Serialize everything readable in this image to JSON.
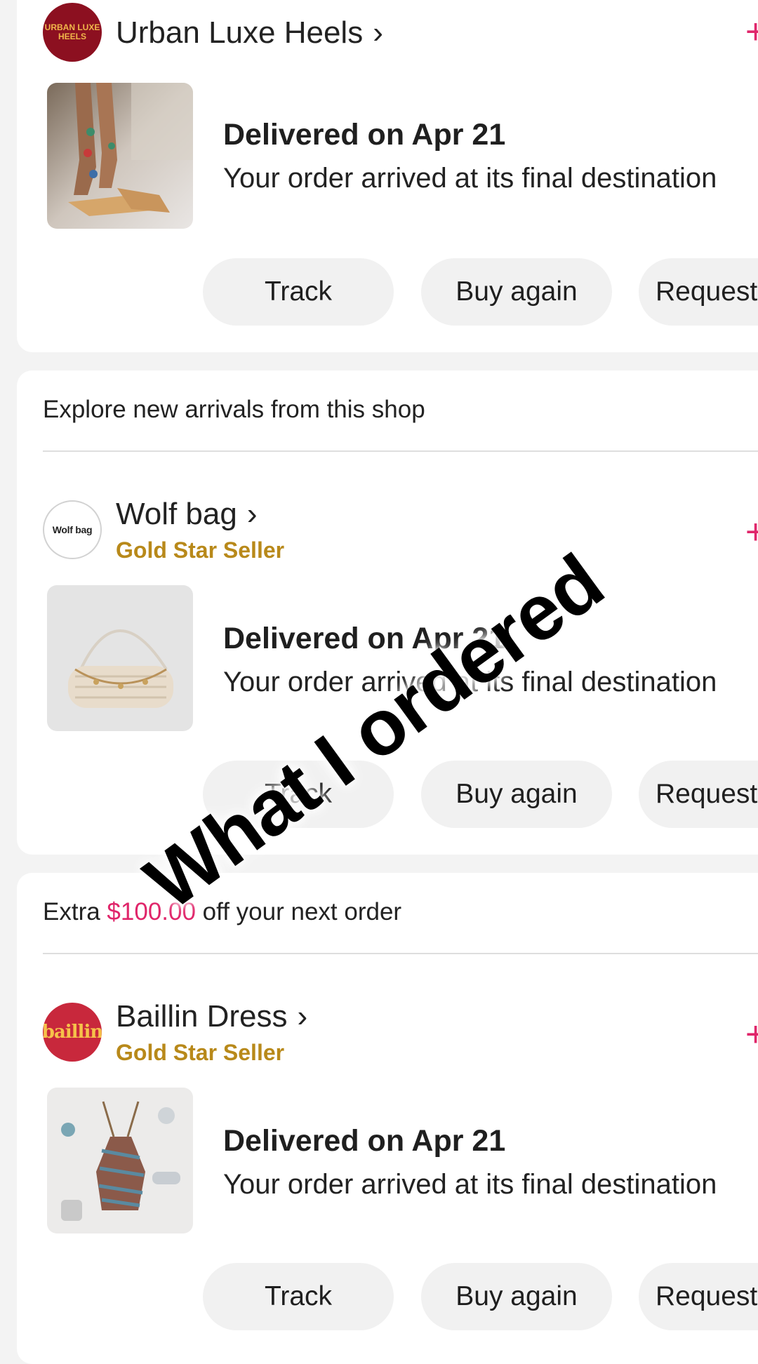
{
  "orders": [
    {
      "shop_name": "Urban Luxe Heels",
      "shop_logo_text": "URBAN LUXE HEELS",
      "seller_badge": "",
      "status_title": "Delivered on Apr 21",
      "status_subtitle": "Your order arrived at its final destination",
      "actions": {
        "track": "Track",
        "buy_again": "Buy again",
        "request": "Request"
      }
    },
    {
      "shop_name": "Wolf bag",
      "shop_logo_text": "Wolf bag",
      "seller_badge": "Gold Star Seller",
      "status_title": "Delivered on Apr 21",
      "status_subtitle": "Your order arrived at its final destination",
      "actions": {
        "track": "Track",
        "buy_again": "Buy again",
        "request": "Request"
      }
    },
    {
      "shop_name": "Baillin Dress",
      "shop_logo_text": "baillin",
      "seller_badge": "Gold Star Seller",
      "status_title": "Delivered on Apr 21",
      "status_subtitle": "Your order arrived at its final destination",
      "actions": {
        "track": "Track",
        "buy_again": "Buy again",
        "request": "Request"
      }
    }
  ],
  "promos": {
    "explore": "Explore new arrivals from this shop",
    "extra_prefix": "Extra ",
    "extra_amount": "$100.00",
    "extra_suffix": " off your next order"
  },
  "icons": {
    "chevron": "›",
    "more": "+"
  },
  "overlay_caption": "What I ordered",
  "colors": {
    "accent": "#e0256a",
    "gold_badge": "#b8891a",
    "button_bg": "#f1f1f1",
    "page_bg": "#f3f3f3"
  }
}
